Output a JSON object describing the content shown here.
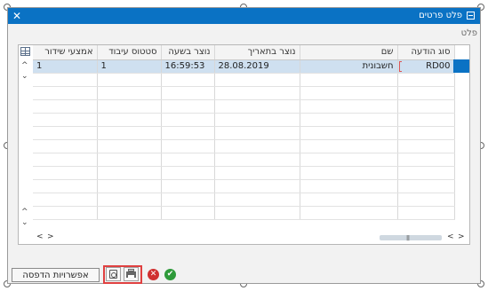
{
  "window": {
    "title": "פלט פרטים",
    "close_glyph": "✕"
  },
  "output_label": "פלט",
  "table": {
    "columns": [
      "אמצעי שידור",
      "סטטוס עיבוד",
      "נוצר בשעה",
      "נוצר בתאריך",
      "שם",
      "סוג הודעה"
    ],
    "rows": [
      {
        "medium": "1",
        "status": "1",
        "time": "16:59:53",
        "date": "28.08.2019",
        "name": "חשבונית",
        "type": "RD00"
      }
    ]
  },
  "buttons": {
    "print_options": "אפשרויות הדפסה",
    "confirm_glyph": "✔",
    "cancel_glyph": "✕"
  },
  "icons": {
    "up": "^",
    "down": "⌄",
    "left": "<",
    "right": ">",
    "grip": "|||"
  },
  "colors": {
    "titlebar": "#0a72c4",
    "selected_row": "#cfe0f0",
    "highlight_border": "#e04040",
    "confirm": "#2e9a3a",
    "cancel": "#d03030"
  }
}
